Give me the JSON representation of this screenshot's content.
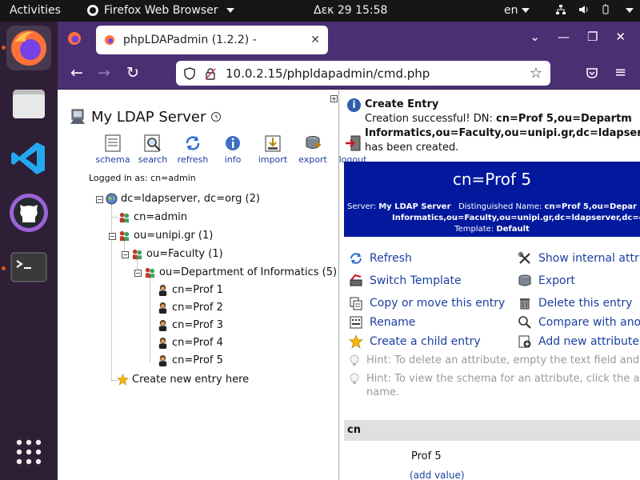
{
  "topbar": {
    "activities": "Activities",
    "app_name": "Firefox Web Browser",
    "clock": "Δεκ 29  15:58",
    "lang": "en"
  },
  "browser": {
    "tab_title": "phpLDAPadmin (1.2.2) -",
    "url": "10.0.2.15/phpldapadmin/cmd.php"
  },
  "tree": {
    "server_title": "My LDAP Server",
    "tools": [
      "schema",
      "search",
      "refresh",
      "info",
      "import",
      "export",
      "logout"
    ],
    "logged_in": "Logged in as: cn=admin",
    "nodes": {
      "root": "dc=ldapserver, dc=org (2)",
      "admin": "cn=admin",
      "unipi": "ou=unipi.gr (1)",
      "faculty": "ou=Faculty (1)",
      "dept": "ou=Department of Informatics (5)",
      "profs": [
        "cn=Prof 1",
        "cn=Prof 2",
        "cn=Prof 3",
        "cn=Prof 4",
        "cn=Prof 5"
      ],
      "create": "Create new entry here"
    }
  },
  "notice": {
    "title": "Create Entry",
    "line1_prefix": "Creation successful! DN: ",
    "line1_dn": "cn=Prof 5,ou=Departm",
    "line2": "Informatics,ou=Faculty,ou=unipi.gr,dc=ldapser",
    "line3": "has been created."
  },
  "entry": {
    "dn_title": "cn=Prof 5",
    "server_label": "Server:",
    "server_value": "My LDAP Server",
    "dn_label": "Distinguished Name:",
    "dn_value": "cn=Prof 5,ou=Depar",
    "dn_value2": "Informatics,ou=Faculty,ou=unipi.gr,dc=ldapserver,dc=o",
    "template_label": "Template:",
    "template_value": "Default"
  },
  "actions": {
    "refresh": "Refresh",
    "show_internal": "Show internal attri",
    "switch_template": "Switch Template",
    "export": "Export",
    "copy_move": "Copy or move this entry",
    "delete": "Delete this entry",
    "rename": "Rename",
    "compare": "Compare with ano",
    "create_child": "Create a child entry",
    "add_attr": "Add new attribute"
  },
  "hints": {
    "hint1": "Hint: To delete an attribute, empty the text field and",
    "hint2a": "Hint: To view the schema for an attribute, click the a",
    "hint2b": "name."
  },
  "attribute": {
    "name": "cn",
    "value": "Prof 5",
    "add_value": "(add value)"
  }
}
